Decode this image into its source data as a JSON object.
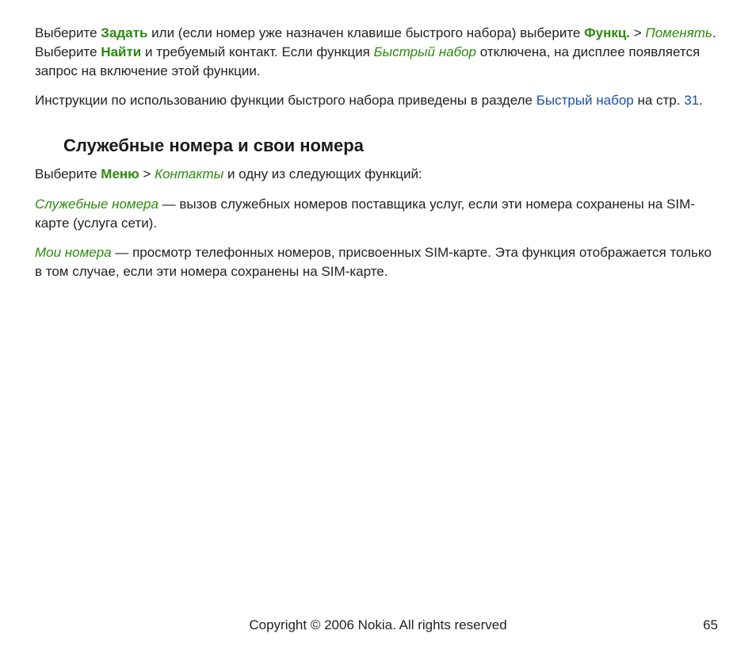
{
  "p1": {
    "t1": "Выберите ",
    "zadat": "Задать",
    "t2": " или (если номер уже назначен клавише быстрого набора) выберите ",
    "funkts": "Функц.",
    "t3": " > ",
    "pomenyat": "Поменять",
    "t4": ". Выберите ",
    "naiti": "Найти",
    "t5": " и требуемый контакт. Если функция ",
    "bystryi_nabor": "Быстрый набор",
    "t6": " отключена, на дисплее появляется запрос на включение этой функции."
  },
  "p2": {
    "t1": "Инструкции по использованию функции быстрого набора приведены в разделе ",
    "link1": "Быстрый набор",
    "t2": " на стр. ",
    "link2": "31",
    "t3": "."
  },
  "heading": "Служебные номера и свои номера",
  "p3": {
    "t1": "Выберите ",
    "menu": "Меню",
    "t2": " > ",
    "kontakty": "Контакты",
    "t3": " и одну из следующих функций:"
  },
  "p4": {
    "sluzh": "Служебные номера",
    "t1": " — вызов служебных номеров поставщика услуг, если эти номера сохранены на SIM-карте (услуга сети)."
  },
  "p5": {
    "moi": "Мои номера",
    "t1": " — просмотр телефонных номеров, присвоенных SIM-карте. Эта функция отображается только в том случае, если эти номера сохранены на SIM-карте."
  },
  "footer": {
    "copyright": "Copyright © 2006 Nokia. All rights reserved",
    "page": "65"
  }
}
